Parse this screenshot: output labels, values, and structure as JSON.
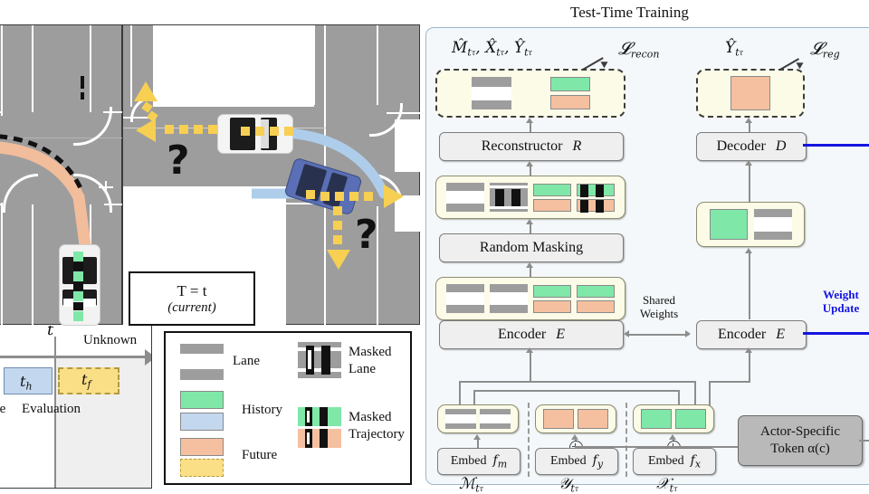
{
  "figure": {
    "ttt_title": "Test-Time Training"
  },
  "scene_b": {
    "time_label_line1": "T = t",
    "time_label_line2": "(current)",
    "question_mark": "?"
  },
  "timeline": {
    "t_label": "t",
    "unknown_label": "Unknown",
    "history_label": "t_h",
    "future_label": "t_f",
    "baseline_label": "ine",
    "evaluation_label": "Evaluation"
  },
  "legend": {
    "items": [
      {
        "label": "Lane",
        "swatch": "lane-swatch"
      },
      {
        "label": "History",
        "swatch": "history-swatch"
      },
      {
        "label": "Future",
        "swatch": "future-swatch"
      },
      {
        "label": "Masked Lane",
        "swatch": "masked-lane-swatch"
      },
      {
        "label": "Masked Trajectory",
        "swatch": "masked-trajectory-swatch"
      }
    ],
    "lane": "Lane",
    "history": "History",
    "future": "Future",
    "masked_lane_l1": "Masked",
    "masked_lane_l2": "Lane",
    "masked_traj_l1": "Masked",
    "masked_traj_l2": "Trajectory"
  },
  "ttt": {
    "nodes": {
      "reconstructor": "Reconstructor",
      "reconstructor_sym": "R",
      "random_masking": "Random Masking",
      "encoder_left": "Encoder",
      "encoder_left_sym": "E",
      "encoder_right": "Encoder",
      "encoder_right_sym": "E",
      "decoder": "Decoder",
      "decoder_sym": "D",
      "embed_m": "Embed",
      "embed_m_sym": "f_m",
      "embed_y": "Embed",
      "embed_y_sym": "f_y",
      "embed_x": "Embed",
      "embed_x_sym": "f_x",
      "actor_token_l1": "Actor-Specific",
      "actor_token_l2": "Token α(c)"
    },
    "labels": {
      "recon_outputs": "M̂_{tτ}, X̂_{tτ}, Ŷ_{tτ}",
      "loss_recon": "L_recon",
      "decoder_output": "Ŷ_{tτ}",
      "loss_reg": "L_reg",
      "shared_weights_l1": "Shared",
      "shared_weights_l2": "Weights",
      "weight_update_l1": "Weight",
      "weight_update_l2": "Update",
      "input_m": "M_{tτ}",
      "input_y": "Y_{tτ}",
      "input_x": "X_{tτ}"
    },
    "colors": {
      "history": "#7fe8a8",
      "future": "#f5c0a0",
      "lane": "#9d9d9d",
      "mask": "#111111",
      "panel_bg": "#f4f8fb",
      "token_bg": "#fbfbe8",
      "weight_update": "#1414e0"
    }
  }
}
